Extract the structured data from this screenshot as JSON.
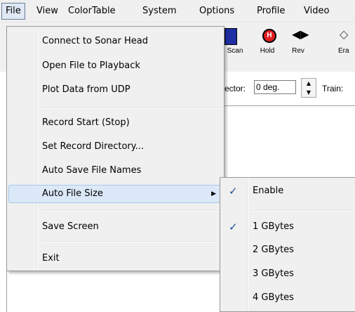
{
  "menubar": {
    "items": [
      "File",
      "View",
      "ColorTable",
      "System",
      "Options",
      "Profile",
      "Video"
    ]
  },
  "toolbar": {
    "scan_label": "Scan",
    "hold_label": "Hold",
    "hold_glyph": "H",
    "rev_label": "Rev",
    "erase_label": "Era",
    "sector_label": "ector:",
    "sector_value": "0 deg.",
    "train_label": "Train:"
  },
  "file_menu": {
    "items": [
      "Connect to Sonar Head",
      "Open File to Playback",
      "Plot Data from UDP",
      "Record  Start (Stop)",
      "Set Record Directory...",
      "Auto Save File Names",
      "Auto File Size",
      "Save Screen",
      "Exit"
    ]
  },
  "submenu": {
    "items": [
      "Enable",
      "1 GBytes",
      "2 GBytes",
      "3 GBytes",
      "4 GBytes"
    ],
    "checked": [
      true,
      true,
      false,
      false,
      false
    ]
  },
  "icons": {
    "checkmark": "✓",
    "submenu_arrow": "▶",
    "spin_up": "▲",
    "spin_down": "▼",
    "rev": "◀▶",
    "erase": "◇"
  },
  "colors": {
    "highlight": "#dbe8f7",
    "check": "#1a4f9c",
    "hold": "#e02020",
    "scan": "#1f2fa3"
  }
}
